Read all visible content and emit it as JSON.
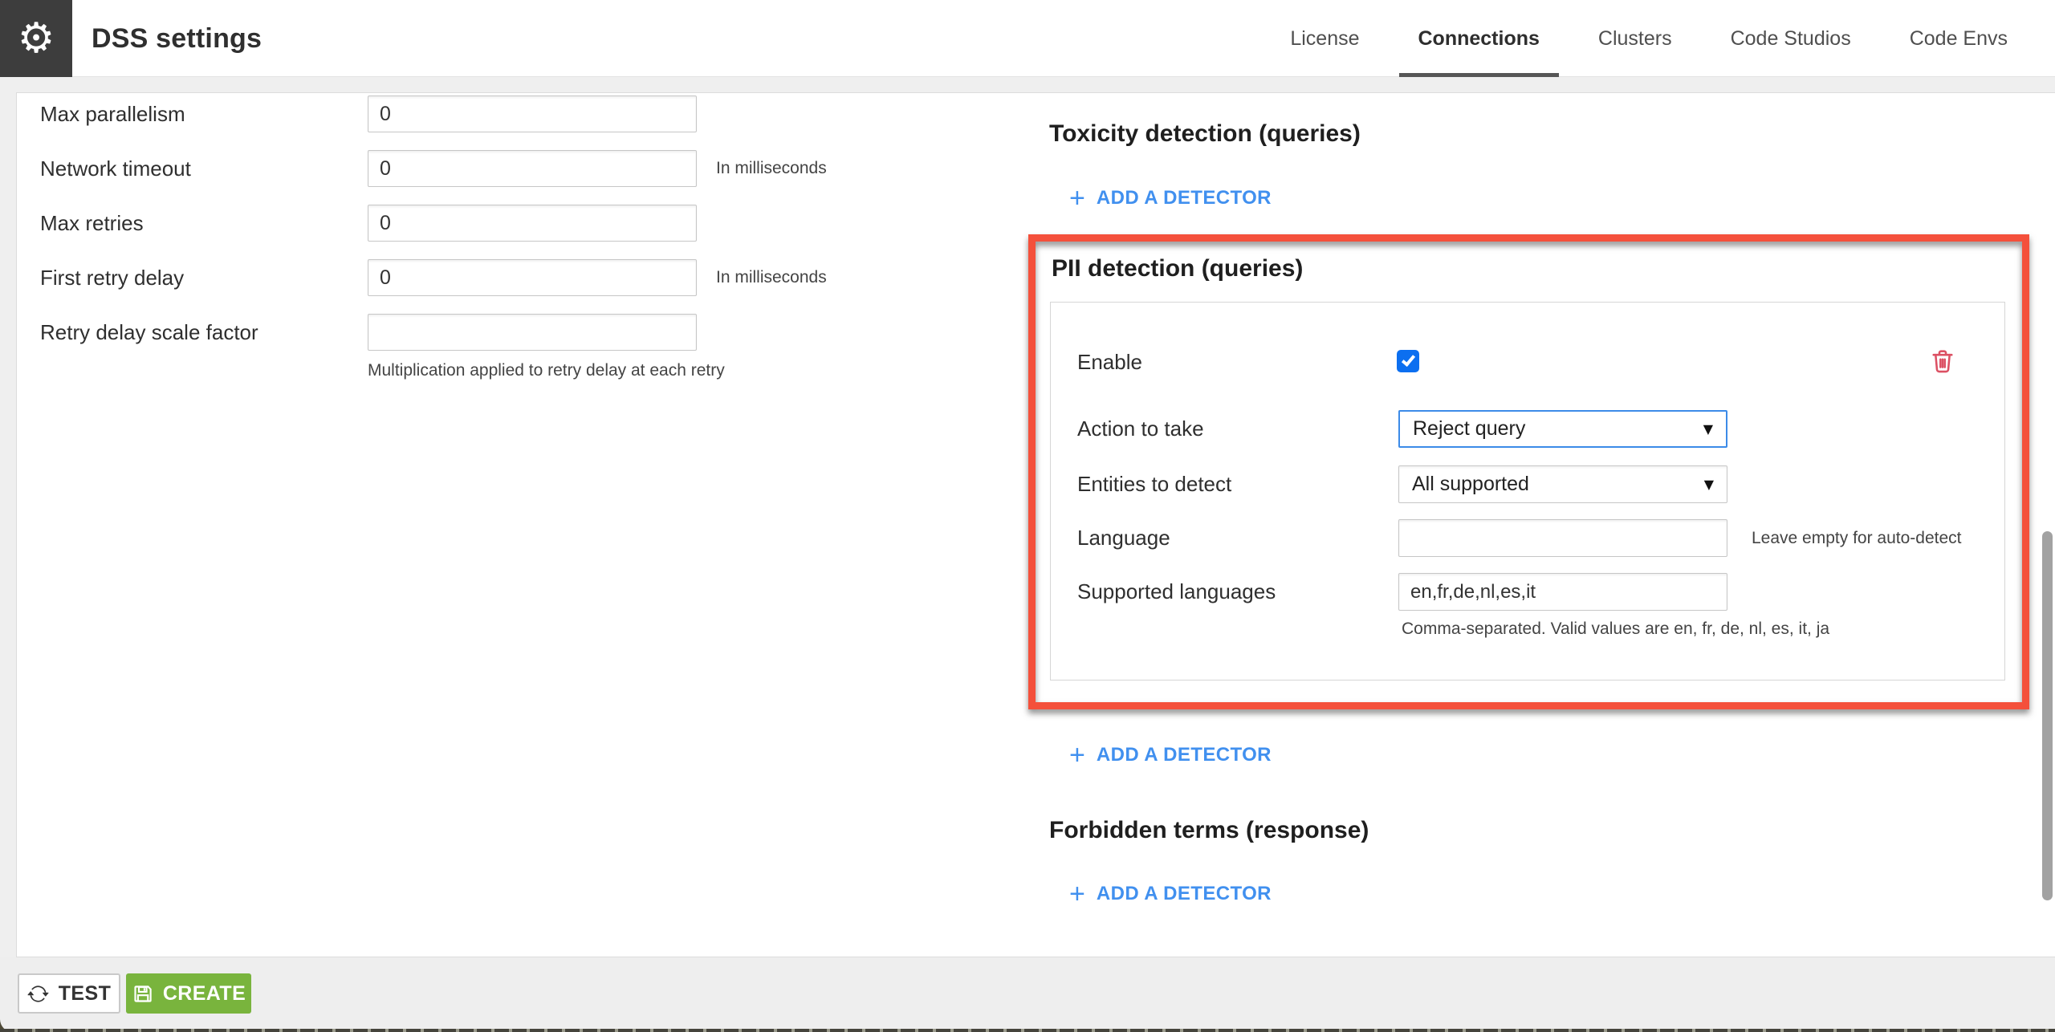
{
  "header": {
    "title": "DSS settings",
    "tabs": [
      {
        "label": "License",
        "active": false
      },
      {
        "label": "Connections",
        "active": true
      },
      {
        "label": "Clusters",
        "active": false
      },
      {
        "label": "Code Studios",
        "active": false
      },
      {
        "label": "Code Envs",
        "active": false
      }
    ]
  },
  "connection_form": {
    "rows": [
      {
        "label": "Max parallelism",
        "value": "0",
        "helper": ""
      },
      {
        "label": "Network timeout",
        "value": "0",
        "helper": "In milliseconds"
      },
      {
        "label": "Max retries",
        "value": "0",
        "helper": ""
      },
      {
        "label": "First retry delay",
        "value": "0",
        "helper": "In milliseconds"
      },
      {
        "label": "Retry delay scale factor",
        "value": "",
        "helper": ""
      }
    ],
    "retry_note": "Multiplication applied to retry delay at each retry"
  },
  "guardrails": {
    "toxicity": {
      "title": "Toxicity detection (queries)",
      "add_label": "ADD A DETECTOR"
    },
    "pii": {
      "title": "PII detection (queries)",
      "enable_label": "Enable",
      "enabled": true,
      "action_label": "Action to take",
      "action_value": "Reject query",
      "entities_label": "Entities to detect",
      "entities_value": "All supported",
      "language_label": "Language",
      "language_value": "",
      "language_helper": "Leave empty for auto-detect",
      "supported_label": "Supported languages",
      "supported_value": "en,fr,de,nl,es,it",
      "supported_helper": "Comma-separated. Valid values are en, fr, de, nl, es, it, ja",
      "add_label": "ADD A DETECTOR"
    },
    "forbidden": {
      "title": "Forbidden terms (response)",
      "add_label": "ADD A DETECTOR"
    }
  },
  "footer": {
    "test_label": "TEST",
    "create_label": "CREATE"
  },
  "icons": {
    "plus": "+",
    "caret_down": "▼",
    "gear": "⚙"
  },
  "colors": {
    "highlight_red": "#f4503b",
    "accent_blue": "#4190ef",
    "checkbox_blue": "#0c6ff0",
    "focus_border_blue": "#3c8be8",
    "create_green": "#79b43d",
    "trash_red": "#dc5164",
    "header_square": "#3d3d3d"
  }
}
